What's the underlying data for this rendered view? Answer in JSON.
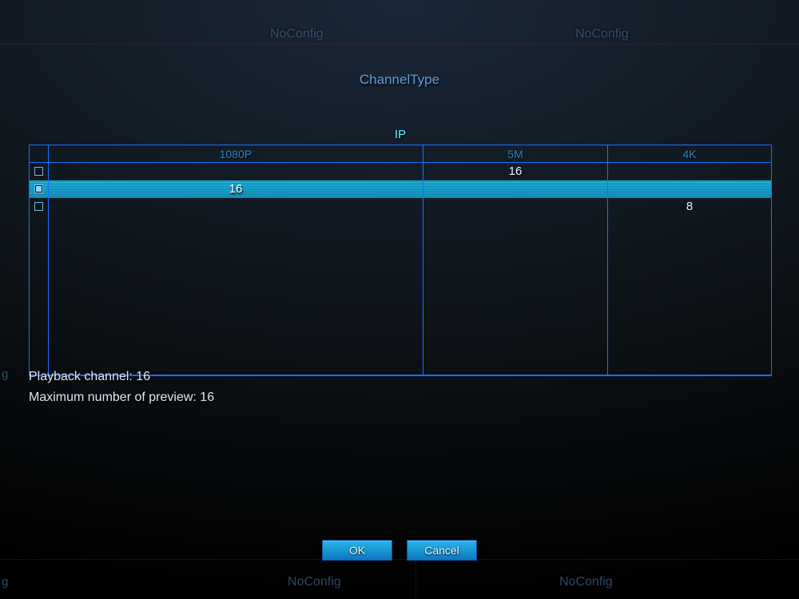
{
  "background": {
    "tile_label": "NoConfig",
    "edge_label_partial": "g"
  },
  "dialog": {
    "title": "ChannelType",
    "ip_group_label": "IP",
    "columns": {
      "col1": "1080P",
      "col2": "5M",
      "col3": "4K"
    },
    "rows": [
      {
        "selected": false,
        "c1": "",
        "c2": "16",
        "c3": ""
      },
      {
        "selected": true,
        "c1": "16",
        "c2": "",
        "c3": ""
      },
      {
        "selected": false,
        "c1": "",
        "c2": "",
        "c3": "8"
      }
    ],
    "info": {
      "playback_label": "Playback channel: 16",
      "preview_label": "Maximum number of preview: 16"
    },
    "buttons": {
      "ok": "OK",
      "cancel": "Cancel"
    }
  },
  "colors": {
    "accent_border": "#1a6fff",
    "highlight": "#17b8e0",
    "text_dim": "#5f9edb"
  }
}
